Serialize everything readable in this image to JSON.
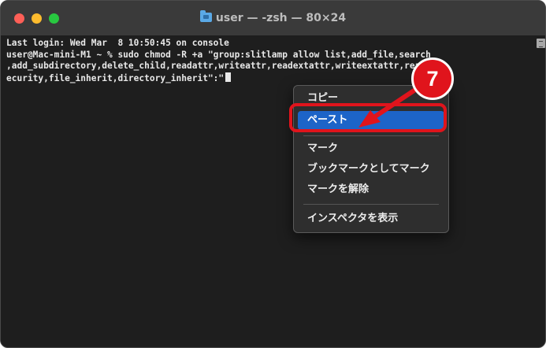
{
  "window": {
    "title": "user — -zsh — 80×24"
  },
  "terminal": {
    "lines": [
      "Last login: Wed Mar  8 10:50:45 on console",
      "user@Mac-mini-M1 ~ % sudo chmod -R +a \"group:slitlamp allow list,add_file,search",
      ",add_subdirectory,delete_child,readattr,writeattr,readextattr,writeextattr,reads",
      "ecurity,file_inherit,directory_inherit\":\""
    ]
  },
  "context_menu": {
    "items": [
      "コピー",
      "ペースト",
      "マーク",
      "ブックマークとしてマーク",
      "マークを解除",
      "インスペクタを表示"
    ],
    "selected": "ペースト"
  },
  "annotation": {
    "step_number": "7",
    "color": "#e0141c"
  }
}
